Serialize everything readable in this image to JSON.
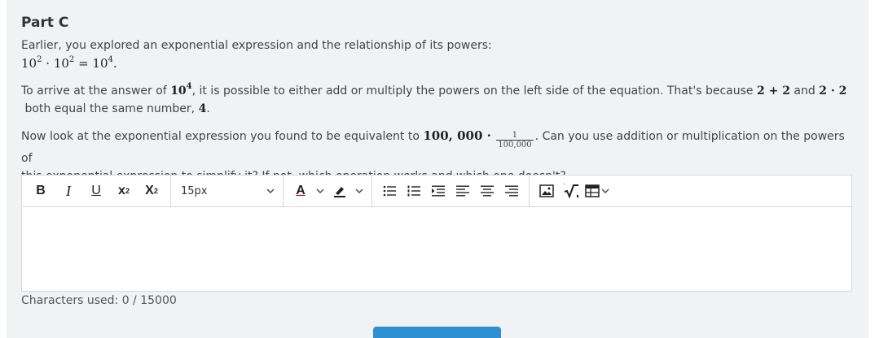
{
  "part_title": "Part C",
  "intro": {
    "text": "Earlier, you explored an exponential expression and the relationship of its powers:"
  },
  "equation": {
    "base": "10",
    "exp_left": "2",
    "dot": "·",
    "exp_mid": "2",
    "equals": "=",
    "exp_right": "4",
    "end": "."
  },
  "para2": {
    "t1": "To arrive at the answer of ",
    "m_base": "10",
    "m_exp": "4",
    "t2": ", it is possible to either add or multiply the powers on the left side of the equation. That's because ",
    "m_add": "2 + 2",
    "t3": " and ",
    "m_mul": "2 · 2",
    "t4": "both equal the same number, ",
    "m_four": "4",
    "t5": "."
  },
  "para3": {
    "t1": "Now look at the exponential expression you found to be equivalent to ",
    "m_num": "100, 000 ·",
    "frac_num": "1",
    "frac_den": "100,000",
    "t2": ". Can you use addition or multiplication on the powers of",
    "t3": "this exponential expression to simplify it? If not, which operation works and which one doesn't?"
  },
  "toolbar": {
    "bold": "B",
    "italic": "I",
    "underline": "U",
    "superscript": "x",
    "superscript_mark": "2",
    "subscript": "X",
    "subscript_mark": "2",
    "font_size": "15px",
    "font_color": "A",
    "chevron": "⌄"
  },
  "char_count": "Characters used: 0 / 15000",
  "colors": {
    "panel": "#f1f2f4",
    "button": "#2f8fd3"
  }
}
